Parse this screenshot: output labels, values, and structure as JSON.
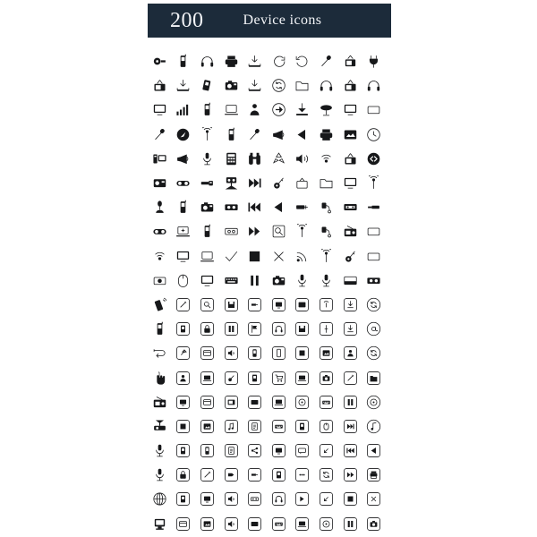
{
  "banner": {
    "count": "200",
    "title": "Device icons",
    "background_color": "#1c2b3a",
    "text_color": "#f2f4f7"
  },
  "grid": {
    "columns": 10,
    "rows": 20,
    "total_icons": 200,
    "icon_color": "#17181a",
    "background_color": "#ffffff"
  },
  "icons": [
    {
      "name": "webcam-icon",
      "style": "solid"
    },
    {
      "name": "mobile-phone-icon",
      "style": "solid"
    },
    {
      "name": "headphones-icon",
      "style": "solid"
    },
    {
      "name": "printer-icon",
      "style": "solid"
    },
    {
      "name": "download-tray-icon",
      "style": "solid"
    },
    {
      "name": "stopwatch-icon",
      "style": "outline"
    },
    {
      "name": "clock-refresh-icon",
      "style": "outline"
    },
    {
      "name": "microphone-stick-icon",
      "style": "solid"
    },
    {
      "name": "television-icon",
      "style": "solid"
    },
    {
      "name": "power-plug-icon",
      "style": "solid"
    },
    {
      "name": "tv-antenna-icon",
      "style": "solid"
    },
    {
      "name": "download-tray-icon",
      "style": "solid"
    },
    {
      "name": "flash-drive-icon",
      "style": "solid"
    },
    {
      "name": "camera-icon",
      "style": "solid"
    },
    {
      "name": "download-tray-icon",
      "style": "solid"
    },
    {
      "name": "refresh-circle-icon",
      "style": "outline"
    },
    {
      "name": "folder-icon",
      "style": "outline"
    },
    {
      "name": "headphones-icon",
      "style": "outline"
    },
    {
      "name": "tv-antenna-icon",
      "style": "solid"
    },
    {
      "name": "headphones-icon",
      "style": "solid"
    },
    {
      "name": "monitor-icon",
      "style": "solid"
    },
    {
      "name": "signal-bars-icon",
      "style": "solid"
    },
    {
      "name": "mobile-phone-icon",
      "style": "outline"
    },
    {
      "name": "laptop-icon",
      "style": "outline"
    },
    {
      "name": "user-profile-icon",
      "style": "solid"
    },
    {
      "name": "arrow-right-circle-icon",
      "style": "outline"
    },
    {
      "name": "download-icon",
      "style": "solid"
    },
    {
      "name": "satellite-dish-icon",
      "style": "solid"
    },
    {
      "name": "monitor-icon",
      "style": "solid"
    },
    {
      "name": "empty-box-icon",
      "style": "outline"
    },
    {
      "name": "microphone-stick-icon",
      "style": "solid"
    },
    {
      "name": "compass-icon",
      "style": "solid"
    },
    {
      "name": "antenna-tower-icon",
      "style": "solid"
    },
    {
      "name": "mobile-phone-icon",
      "style": "solid"
    },
    {
      "name": "microphone-stick-icon",
      "style": "solid"
    },
    {
      "name": "megaphone-icon",
      "style": "solid"
    },
    {
      "name": "play-left-icon",
      "style": "solid"
    },
    {
      "name": "printer-icon",
      "style": "solid"
    },
    {
      "name": "image-frame-icon",
      "style": "solid"
    },
    {
      "name": "clock-icon",
      "style": "outline"
    },
    {
      "name": "desktop-tower-icon",
      "style": "solid"
    },
    {
      "name": "megaphone-icon",
      "style": "solid"
    },
    {
      "name": "microphone-stand-icon",
      "style": "solid"
    },
    {
      "name": "calculator-icon",
      "style": "solid"
    },
    {
      "name": "binoculars-icon",
      "style": "solid"
    },
    {
      "name": "recycle-icon",
      "style": "outline"
    },
    {
      "name": "speaker-volume-icon",
      "style": "solid"
    },
    {
      "name": "wifi-signal-icon",
      "style": "outline"
    },
    {
      "name": "tv-antenna-icon",
      "style": "solid"
    },
    {
      "name": "double-arrow-circle-icon",
      "style": "solid"
    },
    {
      "name": "camera-back-icon",
      "style": "solid"
    },
    {
      "name": "game-controller-icon",
      "style": "solid"
    },
    {
      "name": "usb-plug-icon",
      "style": "solid"
    },
    {
      "name": "video-camera-icon",
      "style": "solid"
    },
    {
      "name": "fast-forward-end-icon",
      "style": "solid"
    },
    {
      "name": "key-icon",
      "style": "solid"
    },
    {
      "name": "tv-small-icon",
      "style": "outline"
    },
    {
      "name": "folder-icon",
      "style": "outline"
    },
    {
      "name": "monitor-icon",
      "style": "outline"
    },
    {
      "name": "antenna-tower-icon",
      "style": "solid"
    },
    {
      "name": "microphone-table-icon",
      "style": "solid"
    },
    {
      "name": "mobile-phone-icon",
      "style": "outline"
    },
    {
      "name": "camera-icon",
      "style": "solid"
    },
    {
      "name": "video-tape-icon",
      "style": "solid"
    },
    {
      "name": "rewind-start-icon",
      "style": "solid"
    },
    {
      "name": "play-left-icon",
      "style": "solid"
    },
    {
      "name": "usb-connector-icon",
      "style": "solid"
    },
    {
      "name": "plug-cable-icon",
      "style": "solid"
    },
    {
      "name": "cassette-icon",
      "style": "solid"
    },
    {
      "name": "usb-stick-icon",
      "style": "solid"
    },
    {
      "name": "game-controller-icon",
      "style": "solid"
    },
    {
      "name": "laptop-plus-icon",
      "style": "outline"
    },
    {
      "name": "mobile-phone-icon",
      "style": "outline"
    },
    {
      "name": "cassette-tape-icon",
      "style": "outline"
    },
    {
      "name": "fast-forward-icon",
      "style": "solid"
    },
    {
      "name": "search-document-icon",
      "style": "outline"
    },
    {
      "name": "antenna-tower-icon",
      "style": "solid"
    },
    {
      "name": "plug-cable-icon",
      "style": "solid"
    },
    {
      "name": "radio-icon",
      "style": "solid"
    },
    {
      "name": "empty-box-icon",
      "style": "outline"
    },
    {
      "name": "wifi-signal-icon",
      "style": "outline"
    },
    {
      "name": "monitor-icon",
      "style": "solid"
    },
    {
      "name": "laptop-icon",
      "style": "solid"
    },
    {
      "name": "checkmark-icon",
      "style": "solid"
    },
    {
      "name": "stop-square-icon",
      "style": "solid"
    },
    {
      "name": "close-x-icon",
      "style": "solid"
    },
    {
      "name": "rss-feed-icon",
      "style": "outline"
    },
    {
      "name": "antenna-tower-icon",
      "style": "solid"
    },
    {
      "name": "key-icon",
      "style": "solid"
    },
    {
      "name": "empty-box-icon",
      "style": "outline"
    },
    {
      "name": "camera-small-icon",
      "style": "outline"
    },
    {
      "name": "computer-mouse-icon",
      "style": "outline"
    },
    {
      "name": "monitor-icon",
      "style": "outline"
    },
    {
      "name": "keyboard-icon",
      "style": "solid"
    },
    {
      "name": "pause-icon",
      "style": "solid"
    },
    {
      "name": "camera-icon",
      "style": "outline"
    },
    {
      "name": "microphone-stand-icon",
      "style": "solid"
    },
    {
      "name": "microphone-stand-icon",
      "style": "solid"
    },
    {
      "name": "scanner-icon",
      "style": "outline"
    },
    {
      "name": "video-tape-icon",
      "style": "solid"
    },
    {
      "name": "mobile-signal-icon",
      "style": "outline"
    },
    {
      "name": "boxed-pen-icon",
      "style": "boxed"
    },
    {
      "name": "boxed-search-icon",
      "style": "boxed"
    },
    {
      "name": "boxed-save-icon",
      "style": "boxed"
    },
    {
      "name": "boxed-plug-icon",
      "style": "boxed"
    },
    {
      "name": "boxed-monitor-icon",
      "style": "boxed"
    },
    {
      "name": "boxed-display-icon",
      "style": "boxed"
    },
    {
      "name": "boxed-antenna-icon",
      "style": "boxed"
    },
    {
      "name": "boxed-download-icon",
      "style": "boxed"
    },
    {
      "name": "boxed-refresh-icon",
      "style": "boxed-round"
    },
    {
      "name": "mobile-phone-icon",
      "style": "outline"
    },
    {
      "name": "boxed-battery-icon",
      "style": "boxed"
    },
    {
      "name": "boxed-lock-icon",
      "style": "boxed"
    },
    {
      "name": "boxed-pause-icon",
      "style": "boxed"
    },
    {
      "name": "boxed-flag-icon",
      "style": "boxed"
    },
    {
      "name": "boxed-headphone-icon",
      "style": "boxed"
    },
    {
      "name": "boxed-save-icon",
      "style": "boxed"
    },
    {
      "name": "boxed-pin-icon",
      "style": "boxed"
    },
    {
      "name": "boxed-download-icon",
      "style": "boxed"
    },
    {
      "name": "boxed-at-icon",
      "style": "boxed-round"
    },
    {
      "name": "cable-loop-icon",
      "style": "outline"
    },
    {
      "name": "boxed-rocket-icon",
      "style": "boxed"
    },
    {
      "name": "boxed-window-icon",
      "style": "boxed"
    },
    {
      "name": "boxed-speaker-icon",
      "style": "boxed"
    },
    {
      "name": "boxed-phone-icon",
      "style": "boxed"
    },
    {
      "name": "boxed-mobile-icon",
      "style": "boxed"
    },
    {
      "name": "boxed-stop-icon",
      "style": "boxed"
    },
    {
      "name": "boxed-image-icon",
      "style": "boxed"
    },
    {
      "name": "boxed-user-icon",
      "style": "boxed"
    },
    {
      "name": "boxed-refresh-icon",
      "style": "boxed-round"
    },
    {
      "name": "pointing-hand-icon",
      "style": "solid"
    },
    {
      "name": "boxed-user-icon",
      "style": "boxed"
    },
    {
      "name": "boxed-laptop-icon",
      "style": "boxed"
    },
    {
      "name": "boxed-key-icon",
      "style": "boxed"
    },
    {
      "name": "boxed-battery-icon",
      "style": "boxed"
    },
    {
      "name": "boxed-cart-icon",
      "style": "boxed"
    },
    {
      "name": "boxed-laptop-icon",
      "style": "boxed"
    },
    {
      "name": "boxed-camera-icon",
      "style": "boxed"
    },
    {
      "name": "boxed-pen-icon",
      "style": "boxed"
    },
    {
      "name": "boxed-folder-icon",
      "style": "boxed"
    },
    {
      "name": "radio-icon",
      "style": "solid"
    },
    {
      "name": "boxed-monitor-icon",
      "style": "boxed"
    },
    {
      "name": "boxed-window-icon",
      "style": "boxed"
    },
    {
      "name": "boxed-tv-icon",
      "style": "boxed"
    },
    {
      "name": "boxed-screen-icon",
      "style": "boxed"
    },
    {
      "name": "boxed-laptop-icon",
      "style": "boxed"
    },
    {
      "name": "boxed-disc-icon",
      "style": "boxed"
    },
    {
      "name": "boxed-keyboard-icon",
      "style": "boxed"
    },
    {
      "name": "boxed-pause-icon",
      "style": "boxed"
    },
    {
      "name": "boxed-disc-icon",
      "style": "boxed-round"
    },
    {
      "name": "projector-icon",
      "style": "solid"
    },
    {
      "name": "boxed-stop-icon",
      "style": "boxed"
    },
    {
      "name": "boxed-image-icon",
      "style": "boxed"
    },
    {
      "name": "boxed-music-icon",
      "style": "boxed"
    },
    {
      "name": "boxed-document-icon",
      "style": "boxed"
    },
    {
      "name": "boxed-keyboard-icon",
      "style": "boxed"
    },
    {
      "name": "boxed-battery-icon",
      "style": "boxed"
    },
    {
      "name": "boxed-mouse-icon",
      "style": "boxed"
    },
    {
      "name": "boxed-skip-icon",
      "style": "boxed"
    },
    {
      "name": "boxed-music-note-icon",
      "style": "boxed-round"
    },
    {
      "name": "microphone-stand-icon",
      "style": "solid"
    },
    {
      "name": "boxed-battery-icon",
      "style": "boxed"
    },
    {
      "name": "boxed-phone-icon",
      "style": "boxed"
    },
    {
      "name": "boxed-document-icon",
      "style": "boxed"
    },
    {
      "name": "boxed-share-icon",
      "style": "boxed"
    },
    {
      "name": "boxed-monitor-icon",
      "style": "boxed"
    },
    {
      "name": "boxed-chat-icon",
      "style": "boxed"
    },
    {
      "name": "boxed-arrow-icon",
      "style": "boxed"
    },
    {
      "name": "boxed-rewind-icon",
      "style": "boxed"
    },
    {
      "name": "boxed-play-left-icon",
      "style": "boxed"
    },
    {
      "name": "microphone-stand-icon",
      "style": "solid"
    },
    {
      "name": "boxed-lock-icon",
      "style": "boxed"
    },
    {
      "name": "boxed-pen-icon",
      "style": "boxed"
    },
    {
      "name": "boxed-tag-icon",
      "style": "boxed"
    },
    {
      "name": "boxed-plug-icon",
      "style": "boxed"
    },
    {
      "name": "boxed-battery-icon",
      "style": "boxed"
    },
    {
      "name": "boxed-dots-icon",
      "style": "boxed"
    },
    {
      "name": "boxed-refresh-icon",
      "style": "boxed"
    },
    {
      "name": "boxed-fast-forward-icon",
      "style": "boxed"
    },
    {
      "name": "boxed-printer-icon",
      "style": "boxed"
    },
    {
      "name": "globe-icon",
      "style": "outline"
    },
    {
      "name": "boxed-battery-icon",
      "style": "boxed"
    },
    {
      "name": "boxed-monitor-icon",
      "style": "boxed"
    },
    {
      "name": "boxed-speaker-icon",
      "style": "boxed"
    },
    {
      "name": "boxed-cassette-icon",
      "style": "boxed"
    },
    {
      "name": "boxed-headphone-icon",
      "style": "boxed"
    },
    {
      "name": "boxed-play-icon",
      "style": "boxed"
    },
    {
      "name": "boxed-arrow-icon",
      "style": "boxed"
    },
    {
      "name": "boxed-stop-icon",
      "style": "boxed"
    },
    {
      "name": "boxed-close-icon",
      "style": "boxed"
    },
    {
      "name": "computer-tower-icon",
      "style": "solid"
    },
    {
      "name": "boxed-window-icon",
      "style": "boxed"
    },
    {
      "name": "boxed-image-icon",
      "style": "boxed"
    },
    {
      "name": "boxed-speaker-icon",
      "style": "boxed"
    },
    {
      "name": "boxed-screen-icon",
      "style": "boxed"
    },
    {
      "name": "boxed-keyboard-icon",
      "style": "boxed"
    },
    {
      "name": "boxed-laptop-icon",
      "style": "boxed"
    },
    {
      "name": "boxed-disc-icon",
      "style": "boxed"
    },
    {
      "name": "boxed-pause-icon",
      "style": "boxed"
    },
    {
      "name": "boxed-camera-icon",
      "style": "boxed"
    }
  ]
}
